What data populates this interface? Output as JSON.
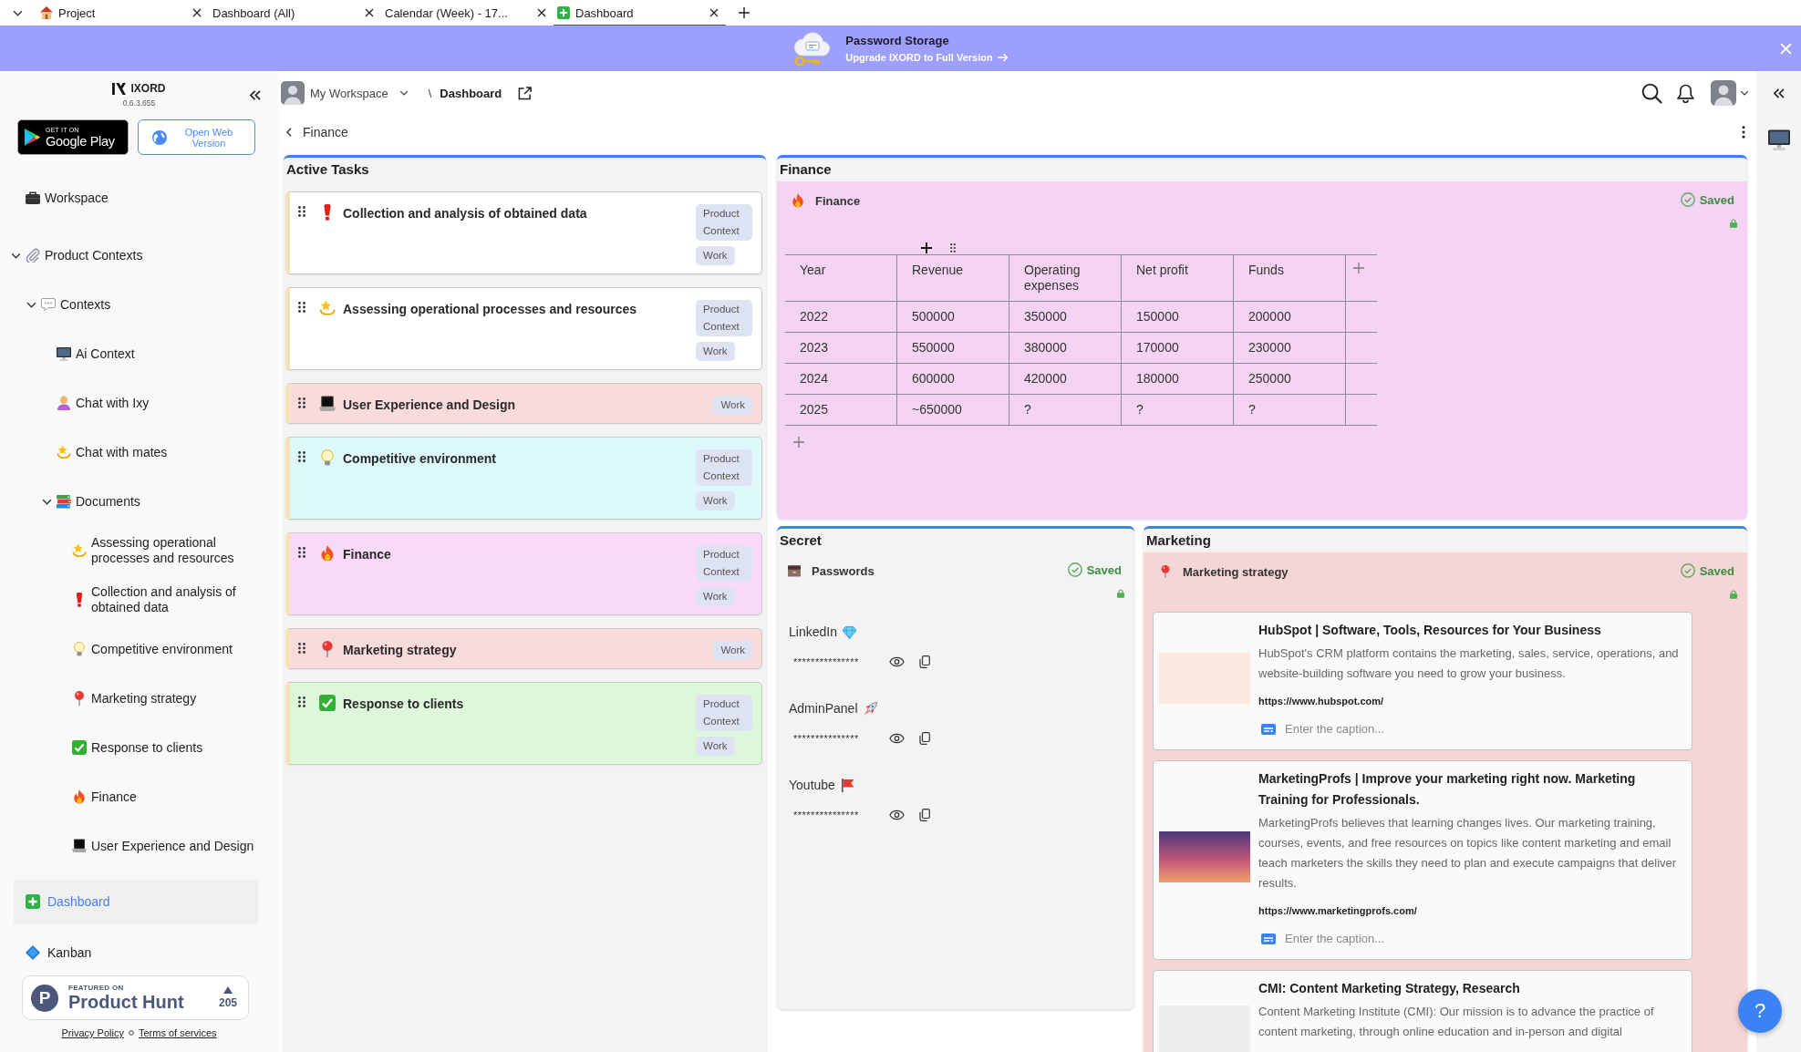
{
  "browser_tabs": [
    {
      "title": "Project",
      "kind": "house",
      "selected": false
    },
    {
      "title": "Dashboard (All)",
      "kind": "plain",
      "selected": false
    },
    {
      "title": "Calendar (Week) - 17...",
      "kind": "plain",
      "selected": false
    },
    {
      "title": "Dashboard",
      "kind": "dashboard",
      "selected": true
    }
  ],
  "banner": {
    "title": "Password Storage",
    "subtitle": "Upgrade IXORD to Full Version"
  },
  "sidebar": {
    "logo": "IXORD",
    "version": "0.6.3.655",
    "store_button": {
      "caption": "GET IT ON",
      "name": "Google Play"
    },
    "web_button": "Open Web Version",
    "tree": [
      {
        "label": "Workspace",
        "kind": "briefcase",
        "selected": false
      },
      {
        "label": "Product Contexts",
        "kind": "paperclip",
        "selected": false,
        "expanded": true,
        "children": [
          {
            "label": "Contexts",
            "kind": "speech",
            "selected": false,
            "expanded": true,
            "children": [
              {
                "label": "Ai Context",
                "kind": "monitor",
                "selected": false
              },
              {
                "label": "Chat with Ixy",
                "kind": "person",
                "selected": false
              },
              {
                "label": "Chat with mates",
                "kind": "sparkle",
                "selected": false
              },
              {
                "label": "Documents",
                "kind": "books",
                "selected": false,
                "expanded": true,
                "children": [
                  {
                    "label": "Assessing operational processes and resources",
                    "kind": "sparkle",
                    "selected": false
                  },
                  {
                    "label": "Collection and analysis of obtained data",
                    "kind": "alert",
                    "selected": false
                  },
                  {
                    "label": "Competitive environment",
                    "kind": "bulb",
                    "selected": false
                  },
                  {
                    "label": "Marketing strategy",
                    "kind": "pin",
                    "selected": false
                  },
                  {
                    "label": "Response to clients",
                    "kind": "check",
                    "selected": false
                  },
                  {
                    "label": "Finance",
                    "kind": "fire",
                    "selected": false
                  },
                  {
                    "label": "User Experience and Design",
                    "kind": "laptop",
                    "selected": false
                  }
                ]
              }
            ]
          }
        ]
      }
    ],
    "pages": [
      {
        "label": "Dashboard",
        "kind": "dashboard",
        "selected": true
      },
      {
        "label": "Kanban",
        "kind": "diamond",
        "selected": false
      }
    ],
    "badge": {
      "logo": "P",
      "caption": "FEATURED ON",
      "name": "Product Hunt",
      "votes": "205"
    },
    "footer_links": [
      "Privacy Policy",
      "Terms of services"
    ]
  },
  "header": {
    "workspace": "My Workspace",
    "separator": "\\",
    "page": "Dashboard"
  },
  "back_link": "Finance",
  "active_tasks": {
    "title": "Active Tasks",
    "cards": [
      {
        "title": "Collection and analysis of obtained data",
        "kind": "alert",
        "color": "#ffffff",
        "tags": [
          "Product Context",
          "Work"
        ]
      },
      {
        "title": "Assessing operational processes and resources",
        "kind": "sparkle",
        "color": "#ffffff",
        "tags": [
          "Product Context",
          "Work"
        ]
      },
      {
        "title": "User Experience and Design",
        "kind": "laptop",
        "color": "#f9dbdb",
        "tags": [
          "Work"
        ]
      },
      {
        "title": "Competitive environment",
        "kind": "bulb",
        "color": "#dcf8fa",
        "tags": [
          "Product Context",
          "Work"
        ]
      },
      {
        "title": "Finance",
        "kind": "fire",
        "color": "#f9d9f9",
        "tags": [
          "Product Context",
          "Work"
        ]
      },
      {
        "title": "Marketing strategy",
        "kind": "pin",
        "color": "#f9dbdb",
        "tags": [
          "Work"
        ]
      },
      {
        "title": "Response to clients",
        "kind": "check",
        "color": "#dcf7d9",
        "tags": [
          "Product Context",
          "Work"
        ]
      }
    ]
  },
  "finance": {
    "title": "Finance",
    "note": {
      "title": "Finance",
      "status": "Saved"
    },
    "table": {
      "columns": [
        "Year",
        "Revenue",
        "Operating expenses",
        "Net profit",
        "Funds"
      ],
      "rows": [
        [
          "2022",
          "500000",
          "350000",
          "150000",
          "200000"
        ],
        [
          "2023",
          "550000",
          "380000",
          "170000",
          "230000"
        ],
        [
          "2024",
          "600000",
          "420000",
          "180000",
          "250000"
        ],
        [
          "2025",
          "~650000",
          "?",
          "?",
          "?"
        ]
      ]
    }
  },
  "secret": {
    "title": "Secret",
    "note": {
      "title": "Passwords",
      "status": "Saved"
    },
    "entries": [
      {
        "label": "LinkedIn",
        "kind": "gem",
        "password": "***************"
      },
      {
        "label": "AdminPanel",
        "kind": "rocket",
        "password": "***************"
      },
      {
        "label": "Youtube",
        "kind": "flag",
        "password": "***************"
      }
    ]
  },
  "marketing": {
    "title": "Marketing",
    "note": {
      "title": "Marketing strategy",
      "status": "Saved"
    },
    "links": [
      {
        "title": "HubSpot | Software, Tools, Resources for Your Business",
        "description": "HubSpot's CRM platform contains the marketing, sales, service, operations, and website-building software you need to grow your business.",
        "url": "https://www.hubspot.com/",
        "caption": {
          "placeholder": "Enter the caption..."
        }
      },
      {
        "title": "MarketingProfs | Improve your marketing right now. Marketing Training for Professionals.",
        "description": "MarketingProfs believes that learning changes lives. Our marketing training, courses, events, and free resources on topics like content marketing and email teach marketers the skills they need to plan and execute campaigns that deliver results.",
        "url": "https://www.marketingprofs.com/",
        "caption": {
          "placeholder": "Enter the caption..."
        }
      },
      {
        "title": "CMI: Content Marketing Strategy, Research",
        "description": "Content Marketing Institute (CMI): Our mission is to advance the practice of content marketing, through online education and in-person and digital"
      }
    ]
  },
  "help_button": "?"
}
